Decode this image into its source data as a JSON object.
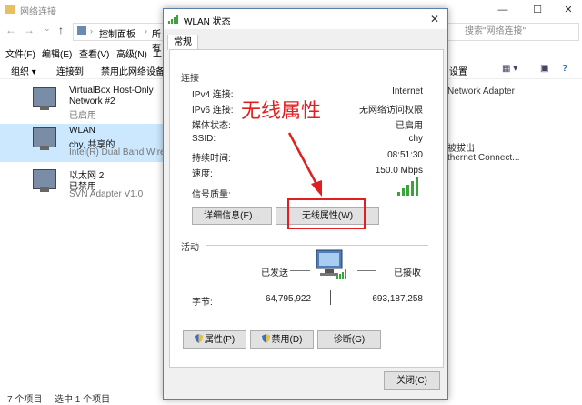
{
  "explorer": {
    "title": "网络连接",
    "breadcrumb": [
      "控制面板",
      "所有"
    ],
    "search_placeholder": "搜索\"网络连接\"",
    "menu": [
      "文件(F)",
      "编辑(E)",
      "查看(V)",
      "高级(N)",
      "工"
    ],
    "toolbar": {
      "organize": "组织 ▾",
      "connect": "连接到",
      "disable": "禁用此网络设备",
      "settings": "设置"
    },
    "adapters": [
      {
        "name": "VirtualBox Host-Only",
        "name2": "Network #2",
        "status": "已启用"
      },
      {
        "name": "WLAN",
        "name2": "chy, 共享的",
        "status": "Intel(R) Dual Band Wirel"
      },
      {
        "name": "以太网 2",
        "name2": "已禁用",
        "status": "SVN Adapter V1.0"
      }
    ],
    "right_text": {
      "adapter": "Network Adapter",
      "unplugged": "被拔出",
      "ethernet": "thernet Connect..."
    },
    "status": {
      "count": "7 个项目",
      "selected": "选中 1 个项目"
    }
  },
  "dialog": {
    "title": "WLAN 状态",
    "tab": "常规",
    "connection": {
      "header": "连接",
      "rows": [
        {
          "label": "IPv4 连接:",
          "value": "Internet"
        },
        {
          "label": "IPv6 连接:",
          "value": "无网络访问权限"
        },
        {
          "label": "媒体状态:",
          "value": "已启用"
        },
        {
          "label": "SSID:",
          "value": "chy"
        },
        {
          "label": "持续时间:",
          "value": "08:51:30"
        },
        {
          "label": "速度:",
          "value": "150.0 Mbps"
        }
      ],
      "signal_label": "信号质量:",
      "signal_bars": 5
    },
    "buttons": {
      "details": "详细信息(E)...",
      "wireless_props": "无线属性(W)"
    },
    "activity": {
      "header": "活动",
      "sent_label": "已发送",
      "recv_label": "已接收",
      "bytes_label": "字节:",
      "sent": "64,795,922",
      "recv": "693,187,258"
    },
    "bottom_buttons": {
      "properties": "属性(P)",
      "disable": "禁用(D)",
      "diagnose": "诊断(G)"
    },
    "close": "关闭(C)"
  },
  "annotation": {
    "text": "无线属性",
    "color": "#e02020"
  },
  "colors": {
    "accent": "#0078d7",
    "selection": "#cce8ff",
    "signal": "#3ca33c"
  }
}
